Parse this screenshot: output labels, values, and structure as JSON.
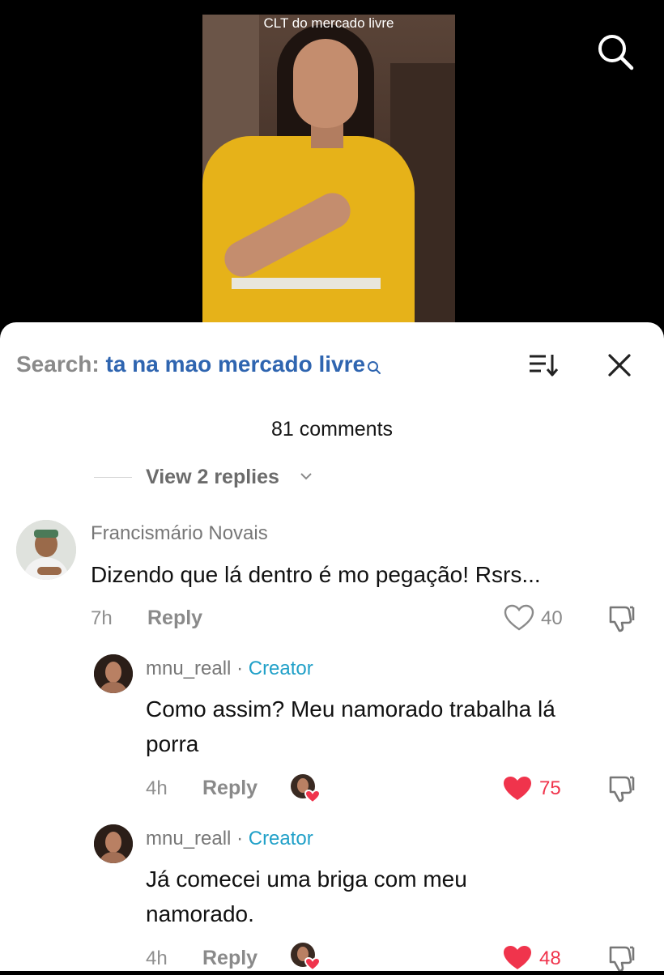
{
  "video": {
    "caption": "CLT do mercado livre"
  },
  "header": {
    "search_label": "Search:",
    "search_term": "ta na mao mercado livre"
  },
  "comments_count": "81 comments",
  "view_replies": "View 2 replies",
  "comments": [
    {
      "username": "Francismário Novais",
      "text": "Dizendo que lá dentro é mo pegação! Rsrs...",
      "time": "7h",
      "reply_label": "Reply",
      "likes": "40",
      "liked": false
    }
  ],
  "replies": [
    {
      "username": "mnu_reall",
      "separator": "·",
      "badge": "Creator",
      "text_lines": [
        "Como assim? Meu namorado trabalha lá",
        "porra"
      ],
      "time": "4h",
      "reply_label": "Reply",
      "likes": "75",
      "liked": true
    },
    {
      "username": "mnu_reall",
      "separator": "·",
      "badge": "Creator",
      "text_lines": [
        "Já comecei uma briga com meu",
        "namorado."
      ],
      "time": "4h",
      "reply_label": "Reply",
      "likes": "48",
      "liked": true
    }
  ],
  "colors": {
    "accent_blue": "#2f65b0",
    "creator_blue": "#20a0c8",
    "like_red": "#f0344c"
  }
}
